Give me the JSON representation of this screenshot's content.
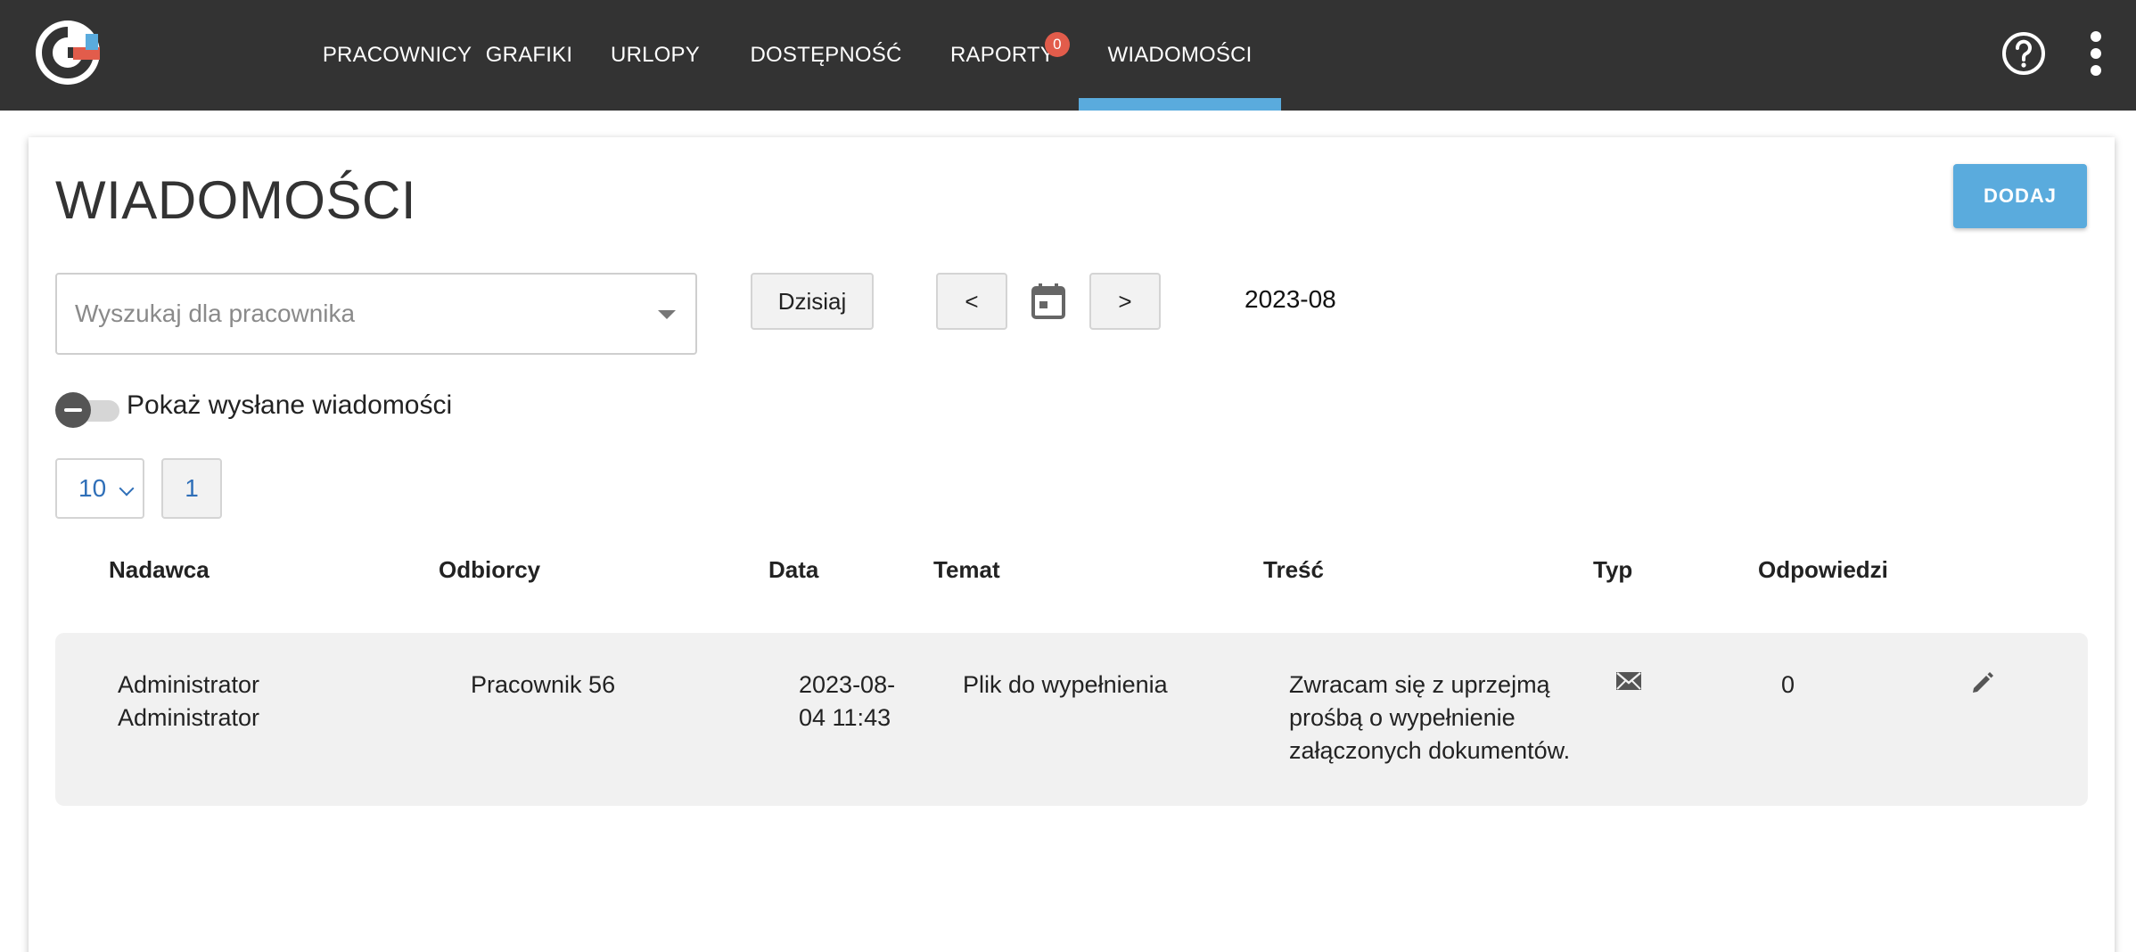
{
  "nav": {
    "items": [
      {
        "label": "PRACOWNICY"
      },
      {
        "label": "GRAFIKI"
      },
      {
        "label": "URLOPY"
      },
      {
        "label": "DOSTĘPNOŚĆ"
      },
      {
        "label": "RAPORTY",
        "badge": "0"
      },
      {
        "label": "WIADOMOŚCI",
        "active": true
      }
    ],
    "help_icon": "question-circle-icon",
    "menu_icon": "more-vertical-icon"
  },
  "page": {
    "title": "WIADOMOŚCI",
    "add_button": "DODAJ"
  },
  "filters": {
    "employee_search_placeholder": "Wyszukaj dla pracownika",
    "today_button": "Dzisiaj",
    "prev_button": "<",
    "next_button": ">",
    "calendar_icon": "calendar-icon",
    "current_month": "2023-08",
    "show_sent_label": "Pokaż wysłane wiadomości",
    "show_sent_enabled": false
  },
  "pagination": {
    "page_size": "10",
    "current_page": "1"
  },
  "table": {
    "columns": [
      "Nadawca",
      "Odbiorcy",
      "Data",
      "Temat",
      "Treść",
      "Typ",
      "Odpowiedzi"
    ],
    "rows": [
      {
        "sender": "Administrator Administrator",
        "recipients": "Pracownik 56",
        "date": "2023-08-04 11:43",
        "subject": "Plik do wypełnienia",
        "content": "Zwracam się z uprzejmą prośbą o wypełnienie załączonych dokumentów.",
        "type_icon": "envelope-icon",
        "replies": "0",
        "edit_icon": "pencil-icon"
      }
    ]
  },
  "colors": {
    "topbar": "#333333",
    "accent": "#5aabdd",
    "badge": "#e25c4b",
    "link": "#2f6fb8",
    "row_bg": "#f1f1f1"
  }
}
